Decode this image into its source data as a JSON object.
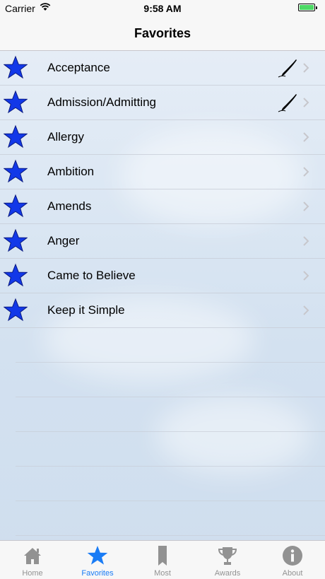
{
  "status_bar": {
    "carrier": "Carrier",
    "time": "9:58 AM"
  },
  "nav": {
    "title": "Favorites"
  },
  "favorites": [
    {
      "label": "Acceptance",
      "has_note": true
    },
    {
      "label": "Admission/Admitting",
      "has_note": true
    },
    {
      "label": "Allergy",
      "has_note": false
    },
    {
      "label": "Ambition",
      "has_note": false
    },
    {
      "label": "Amends",
      "has_note": false
    },
    {
      "label": "Anger",
      "has_note": false
    },
    {
      "label": "Came to Believe",
      "has_note": false
    },
    {
      "label": "Keep it Simple",
      "has_note": false
    }
  ],
  "tabs": [
    {
      "label": "Home",
      "icon": "home-icon",
      "active": false
    },
    {
      "label": "Favorites",
      "icon": "star-icon",
      "active": true
    },
    {
      "label": "Most",
      "icon": "bookmark-icon",
      "active": false
    },
    {
      "label": "Awards",
      "icon": "trophy-icon",
      "active": false
    },
    {
      "label": "About",
      "icon": "info-icon",
      "active": false
    }
  ],
  "colors": {
    "star": "#1238e8",
    "active_tab": "#1a7cf5",
    "inactive_tab": "#929292",
    "battery": "#4cd964"
  }
}
